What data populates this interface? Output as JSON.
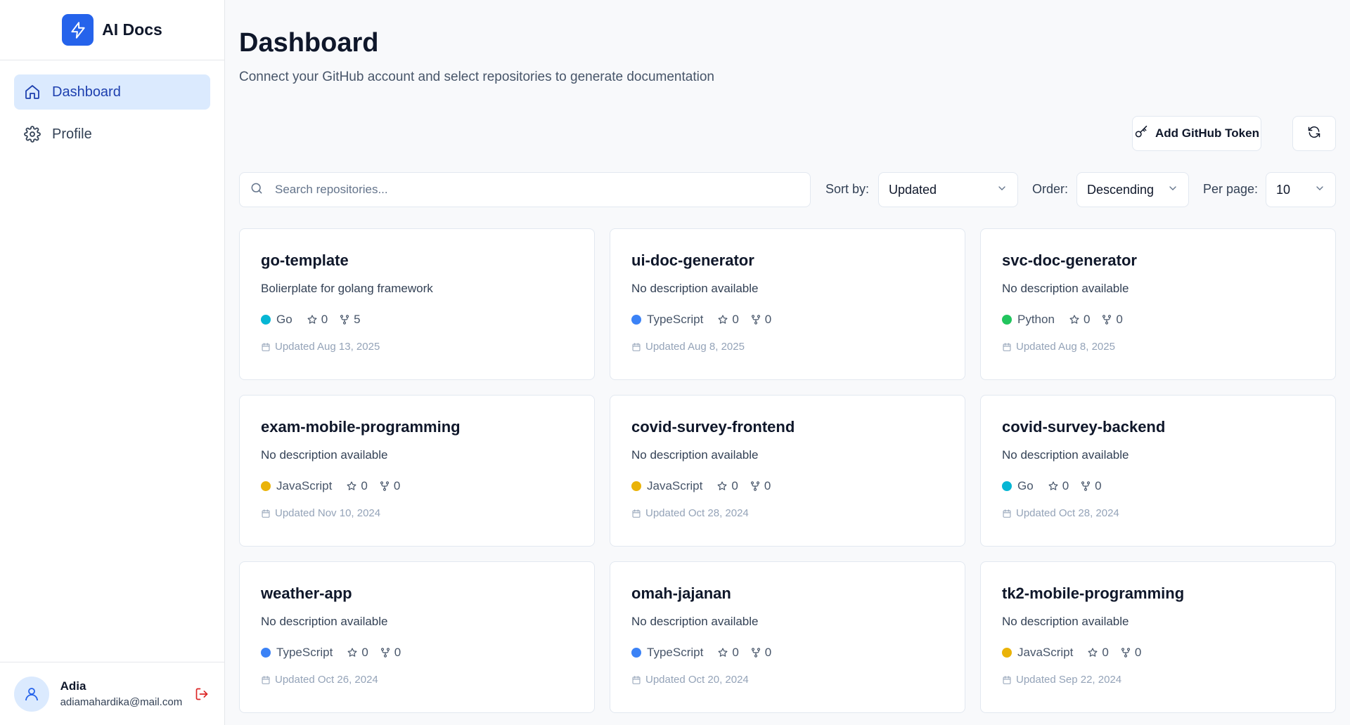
{
  "app": {
    "name": "AI Docs",
    "accent": "#2563eb"
  },
  "sidebar": {
    "items": [
      {
        "label": "Dashboard",
        "icon": "home-icon",
        "active": true
      },
      {
        "label": "Profile",
        "icon": "gear-icon",
        "active": false
      }
    ],
    "user": {
      "name": "Adia",
      "email": "adiamahardika@mail.com"
    }
  },
  "header": {
    "title": "Dashboard",
    "subtitle": "Connect your GitHub account and select repositories to generate documentation",
    "add_token_label": "Add GitHub Token"
  },
  "filters": {
    "search_placeholder": "Search repositories...",
    "sort_label": "Sort by:",
    "sort_value": "Updated",
    "order_label": "Order:",
    "order_value": "Descending",
    "per_page_label": "Per page:",
    "per_page_value": "10"
  },
  "languages": {
    "Go": "#06b6d4",
    "TypeScript": "#3b82f6",
    "Python": "#22c55e",
    "JavaScript": "#eab308"
  },
  "repositories": [
    {
      "name": "go-template",
      "description": "Bolierplate for golang framework",
      "language": "Go",
      "stars": "0",
      "forks": "5",
      "updated": "Updated Aug 13, 2025"
    },
    {
      "name": "ui-doc-generator",
      "description": "No description available",
      "language": "TypeScript",
      "stars": "0",
      "forks": "0",
      "updated": "Updated Aug 8, 2025"
    },
    {
      "name": "svc-doc-generator",
      "description": "No description available",
      "language": "Python",
      "stars": "0",
      "forks": "0",
      "updated": "Updated Aug 8, 2025"
    },
    {
      "name": "exam-mobile-programming",
      "description": "No description available",
      "language": "JavaScript",
      "stars": "0",
      "forks": "0",
      "updated": "Updated Nov 10, 2024"
    },
    {
      "name": "covid-survey-frontend",
      "description": "No description available",
      "language": "JavaScript",
      "stars": "0",
      "forks": "0",
      "updated": "Updated Oct 28, 2024"
    },
    {
      "name": "covid-survey-backend",
      "description": "No description available",
      "language": "Go",
      "stars": "0",
      "forks": "0",
      "updated": "Updated Oct 28, 2024"
    },
    {
      "name": "weather-app",
      "description": "No description available",
      "language": "TypeScript",
      "stars": "0",
      "forks": "0",
      "updated": "Updated Oct 26, 2024"
    },
    {
      "name": "omah-jajanan",
      "description": "No description available",
      "language": "TypeScript",
      "stars": "0",
      "forks": "0",
      "updated": "Updated Oct 20, 2024"
    },
    {
      "name": "tk2-mobile-programming",
      "description": "No description available",
      "language": "JavaScript",
      "stars": "0",
      "forks": "0",
      "updated": "Updated Sep 22, 2024"
    }
  ]
}
